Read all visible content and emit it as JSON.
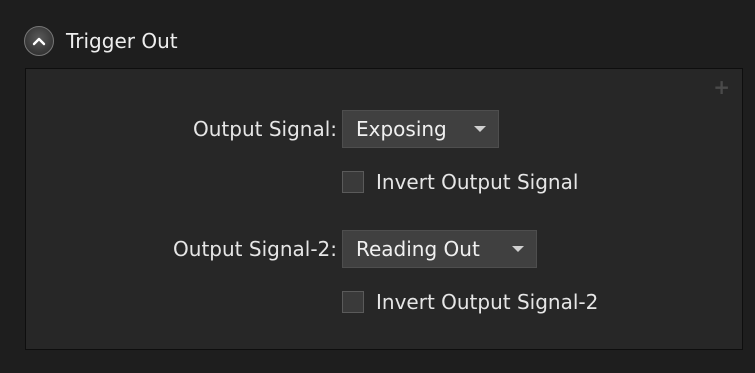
{
  "section": {
    "title": "Trigger Out",
    "collapse_icon": "chevron-up-circle-icon",
    "add_icon_glyph": "+"
  },
  "output_signal": {
    "label": "Output Signal:",
    "value": "Exposing",
    "invert_label": "Invert Output Signal",
    "invert_checked": false
  },
  "output_signal_2": {
    "label": "Output Signal-2:",
    "value": "Reading Out",
    "invert_label": "Invert Output Signal-2",
    "invert_checked": false
  },
  "colors": {
    "background": "#1e1e1e",
    "panel": "#272727",
    "combo": "#404040",
    "text": "#e6e6e6"
  }
}
